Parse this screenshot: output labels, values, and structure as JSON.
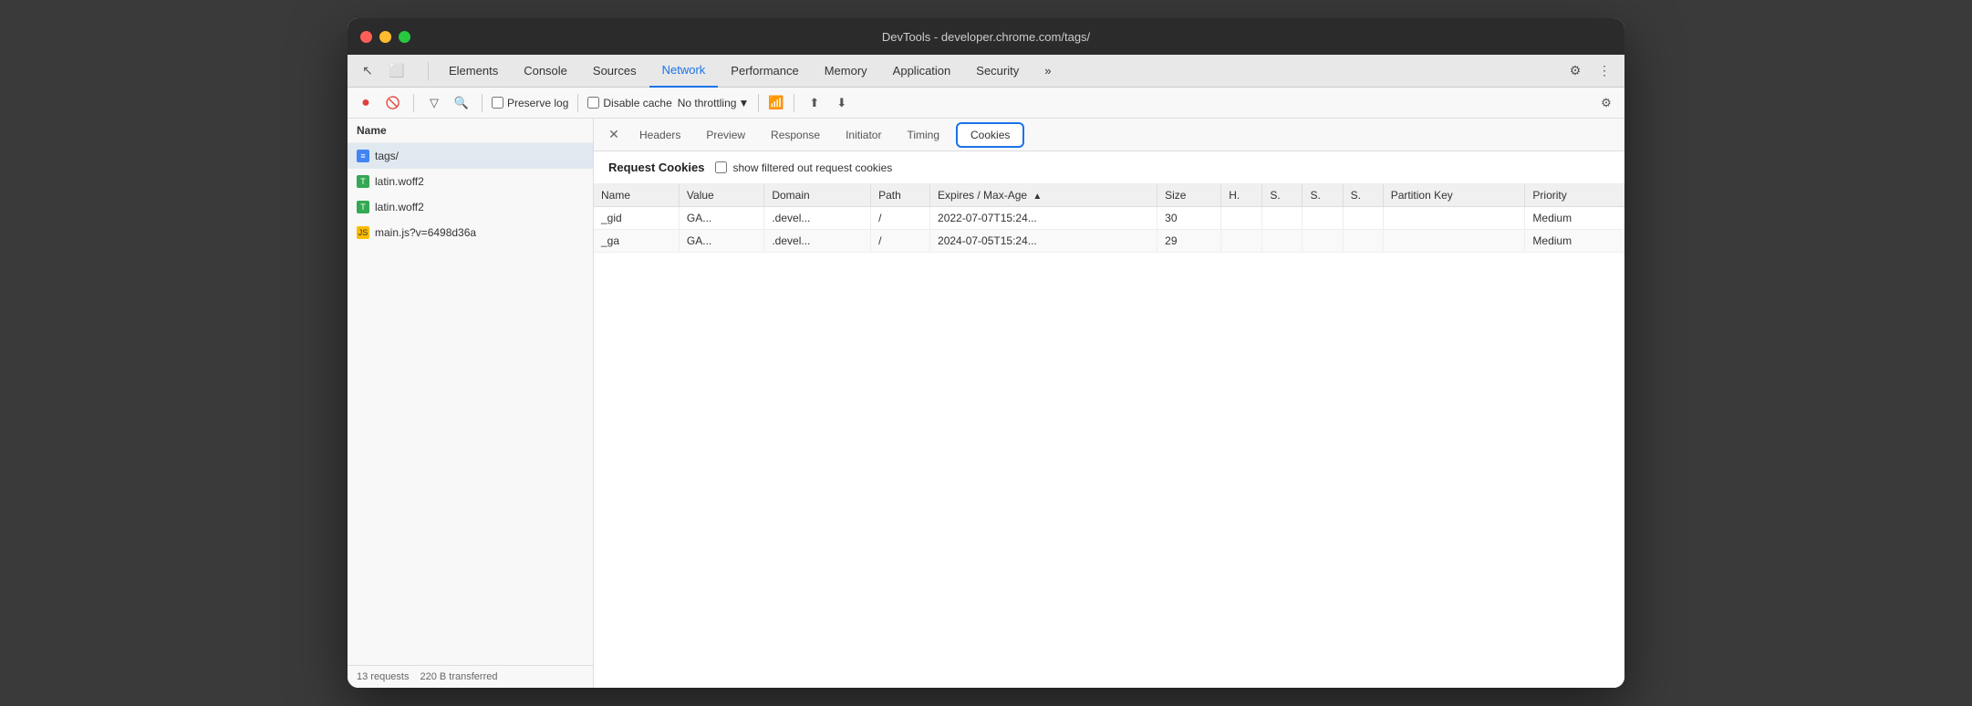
{
  "window": {
    "title": "DevTools - developer.chrome.com/tags/"
  },
  "tabs": {
    "items": [
      {
        "label": "Elements",
        "active": false
      },
      {
        "label": "Console",
        "active": false
      },
      {
        "label": "Sources",
        "active": false
      },
      {
        "label": "Network",
        "active": true
      },
      {
        "label": "Performance",
        "active": false
      },
      {
        "label": "Memory",
        "active": false
      },
      {
        "label": "Application",
        "active": false
      },
      {
        "label": "Security",
        "active": false
      },
      {
        "label": "»",
        "active": false
      }
    ]
  },
  "toolbar": {
    "preserve_log_label": "Preserve log",
    "disable_cache_label": "Disable cache",
    "throttle_label": "No throttling"
  },
  "left_panel": {
    "header": "Name",
    "files": [
      {
        "name": "tags/",
        "type": "doc",
        "selected": true
      },
      {
        "name": "latin.woff2",
        "type": "font"
      },
      {
        "name": "latin.woff2",
        "type": "font"
      },
      {
        "name": "main.js?v=6498d36a",
        "type": "js"
      }
    ],
    "footer": {
      "requests": "13 requests",
      "transferred": "220 B transferred"
    }
  },
  "inner_tabs": {
    "items": [
      {
        "label": "Headers"
      },
      {
        "label": "Preview"
      },
      {
        "label": "Response"
      },
      {
        "label": "Initiator"
      },
      {
        "label": "Timing"
      },
      {
        "label": "Cookies",
        "active": true
      }
    ]
  },
  "request_cookies": {
    "title": "Request Cookies",
    "show_filtered_label": "show filtered out request cookies",
    "table": {
      "headers": [
        {
          "label": "Name",
          "class": "col-name"
        },
        {
          "label": "Value",
          "class": "col-value"
        },
        {
          "label": "Domain",
          "class": "col-domain"
        },
        {
          "label": "Path",
          "class": "col-path"
        },
        {
          "label": "Expires / Max-Age",
          "class": "col-expires",
          "sort": "▲"
        },
        {
          "label": "Size",
          "class": "col-size"
        },
        {
          "label": "H.",
          "class": "col-h"
        },
        {
          "label": "S.",
          "class": "col-s1"
        },
        {
          "label": "S.",
          "class": "col-s2"
        },
        {
          "label": "S.",
          "class": "col-s3"
        },
        {
          "label": "Partition Key",
          "class": "col-pk"
        },
        {
          "label": "Priority",
          "class": "col-priority"
        }
      ],
      "rows": [
        {
          "name": "_gid",
          "value": "GA...",
          "domain": ".devel...",
          "path": "/",
          "expires": "2022-07-07T15:24...",
          "size": "30",
          "h": "",
          "s1": "",
          "s2": "",
          "s3": "",
          "partition_key": "",
          "priority": "Medium"
        },
        {
          "name": "_ga",
          "value": "GA...",
          "domain": ".devel...",
          "path": "/",
          "expires": "2024-07-05T15:24...",
          "size": "29",
          "h": "",
          "s1": "",
          "s2": "",
          "s3": "",
          "partition_key": "",
          "priority": "Medium"
        }
      ]
    }
  }
}
